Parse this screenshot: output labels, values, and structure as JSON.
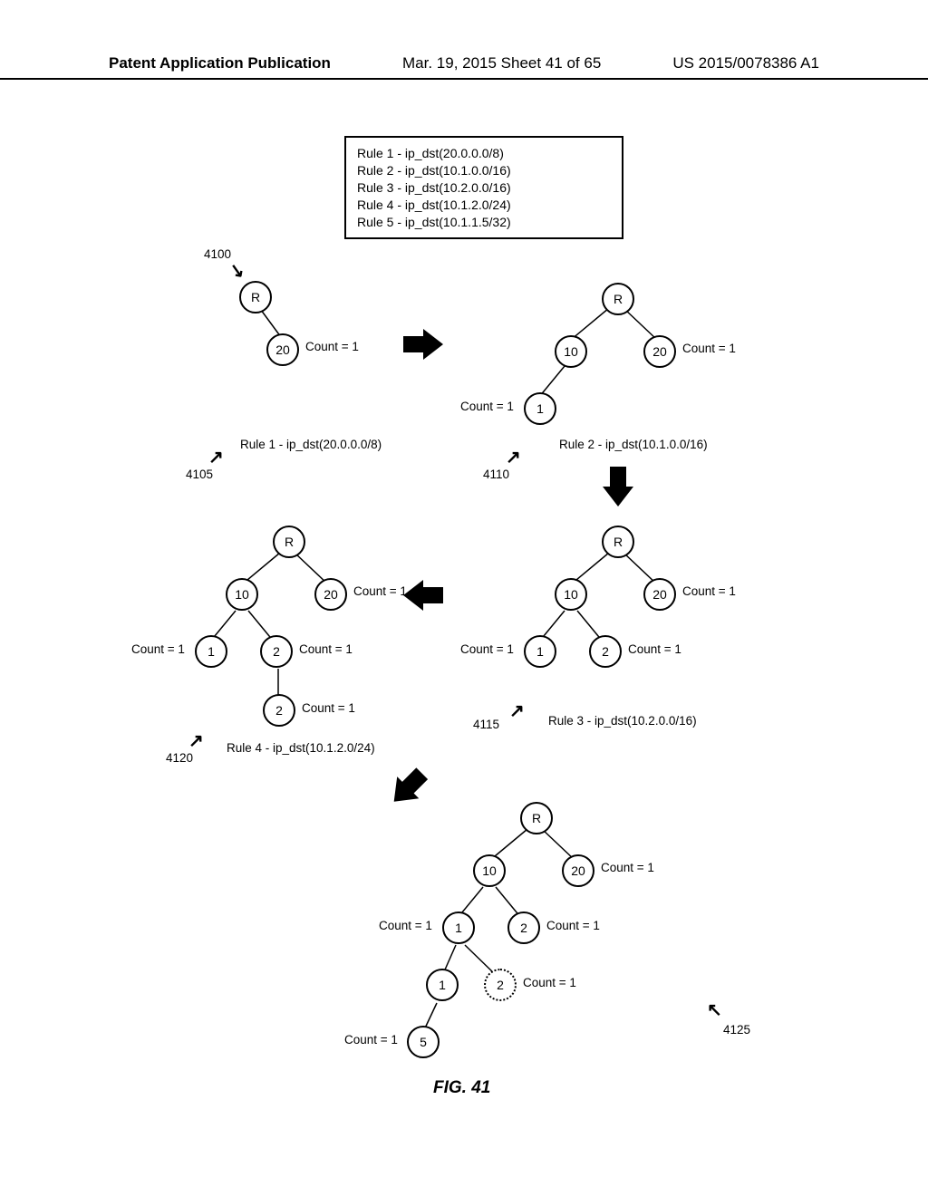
{
  "header": {
    "left": "Patent Application Publication",
    "center": "Mar. 19, 2015  Sheet 41 of 65",
    "right": "US 2015/0078386 A1"
  },
  "rules": {
    "r1": "Rule 1 - ip_dst(20.0.0.0/8)",
    "r2": "Rule 2 - ip_dst(10.1.0.0/16)",
    "r3": "Rule 3 - ip_dst(10.2.0.0/16)",
    "r4": "Rule 4 - ip_dst(10.1.2.0/24)",
    "r5": "Rule 5 - ip_dst(10.1.1.5/32)"
  },
  "refs": {
    "t4100": "4100",
    "t4105": "4105",
    "t4110": "4110",
    "t4115": "4115",
    "t4120": "4120",
    "t4125": "4125"
  },
  "step_labels": {
    "s4105": "Rule 1 - ip_dst(20.0.0.0/8)",
    "s4110": "Rule 2 - ip_dst(10.1.0.0/16)",
    "s4115": "Rule 3 - ip_dst(10.2.0.0/16)",
    "s4120": "Rule 4 - ip_dst(10.1.2.0/24)"
  },
  "nodes": {
    "R": "R",
    "n10": "10",
    "n20": "20",
    "n1": "1",
    "n2": "2",
    "n5": "5"
  },
  "count": "Count = 1",
  "figure": "FIG. 41"
}
